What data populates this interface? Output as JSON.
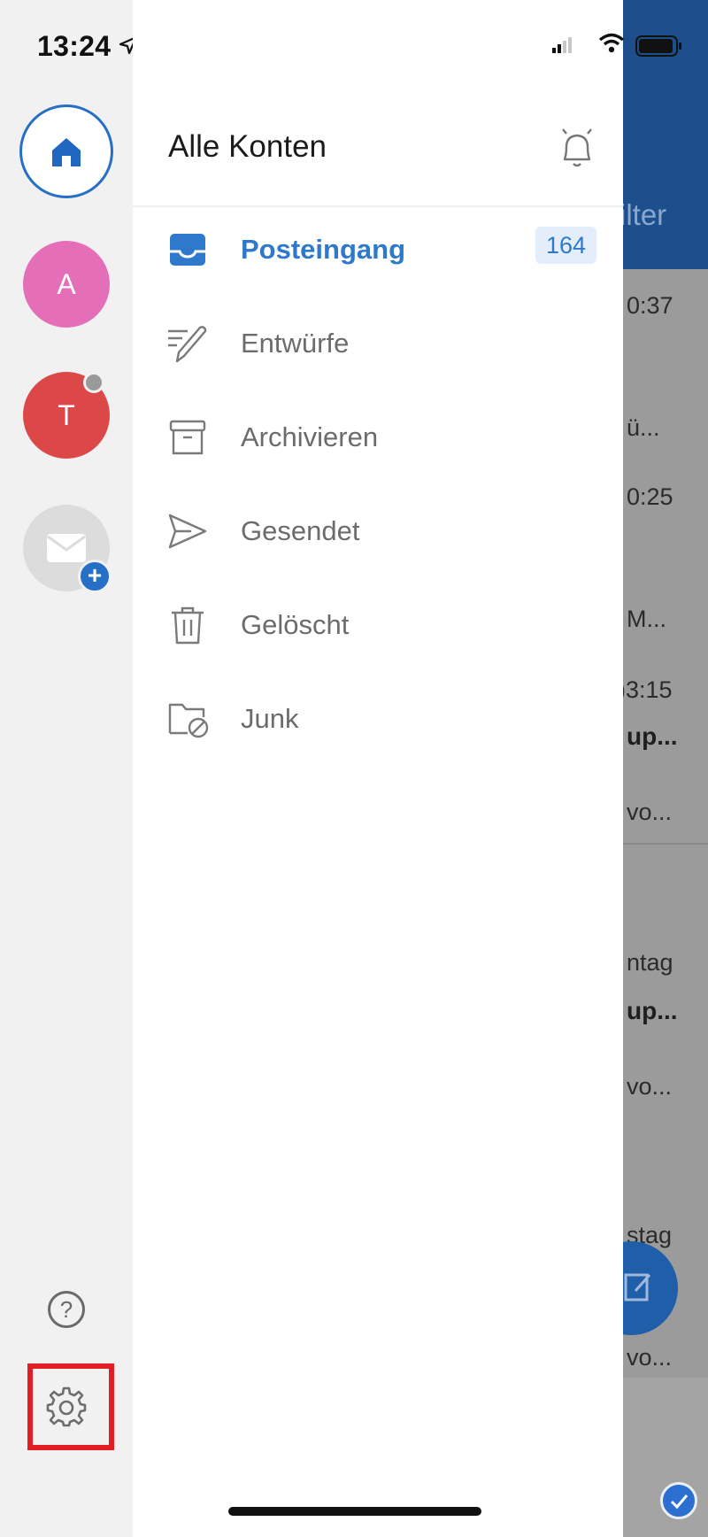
{
  "status_bar": {
    "time": "13:24"
  },
  "rail": {
    "accounts": [
      {
        "kind": "home",
        "label": ""
      },
      {
        "kind": "account",
        "label": "A",
        "color": "#e46fb8"
      },
      {
        "kind": "account",
        "label": "T",
        "color": "#dc4848"
      },
      {
        "kind": "add-account",
        "label": ""
      }
    ],
    "help_label": "?"
  },
  "drawer": {
    "title": "Alle Konten",
    "folders": [
      {
        "label": "Posteingang",
        "icon": "inbox-icon",
        "active": true,
        "badge": "164"
      },
      {
        "label": "Entwürfe",
        "icon": "drafts-icon"
      },
      {
        "label": "Archivieren",
        "icon": "archive-icon"
      },
      {
        "label": "Gesendet",
        "icon": "sent-icon"
      },
      {
        "label": "Gelöscht",
        "icon": "trash-icon"
      },
      {
        "label": "Junk",
        "icon": "junk-folder-icon"
      }
    ]
  },
  "background_list": {
    "filter_label": "ilter",
    "fragments": [
      "0:37",
      "ü...",
      "0:25",
      "M...",
      ")3:15",
      "up...",
      "vo...",
      "ntag",
      "up...",
      "vo...",
      "stag",
      "vo..."
    ]
  },
  "colors": {
    "accent": "#2f79cc",
    "highlight": "#e31d24",
    "header": "#1d4f8c"
  }
}
